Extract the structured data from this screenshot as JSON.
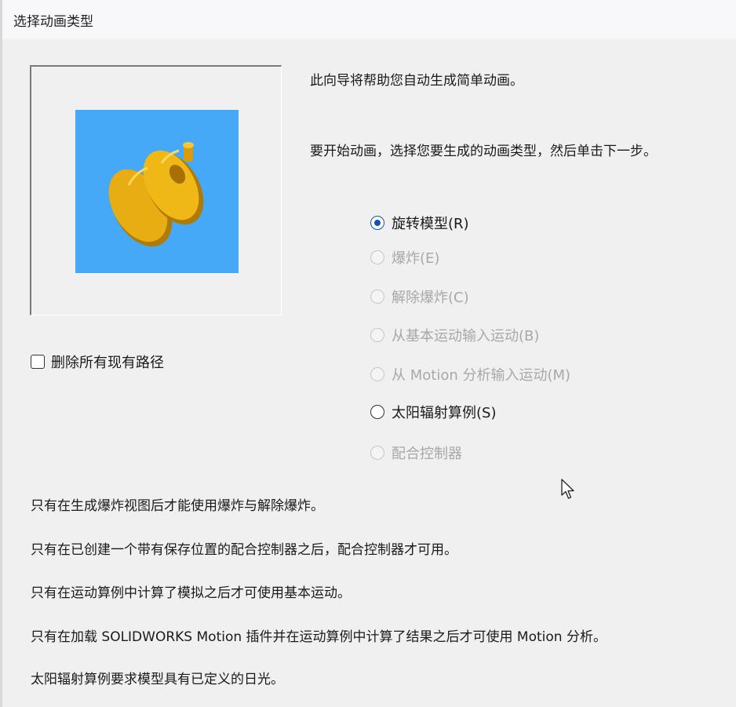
{
  "window": {
    "title": "选择动画类型"
  },
  "intro": {
    "line1": "此向导将帮助您自动生成简单动画。",
    "line2": "要开始动画，选择您要生成的动画类型，然后单击下一步。"
  },
  "preview": {
    "icon": "gear-part-3d-model",
    "background_color": "#45a9f7",
    "part_color": "#e8ad12"
  },
  "options": [
    {
      "label": "旋转模型(R)",
      "checked": true,
      "enabled": true
    },
    {
      "label": "爆炸(E)",
      "checked": false,
      "enabled": false
    },
    {
      "label": "解除爆炸(C)",
      "checked": false,
      "enabled": false
    },
    {
      "label": "从基本运动输入运动(B)",
      "checked": false,
      "enabled": false
    },
    {
      "label": "从 Motion 分析输入运动(M)",
      "checked": false,
      "enabled": false
    },
    {
      "label": "太阳辐射算例(S)",
      "checked": false,
      "enabled": true
    },
    {
      "label": "配合控制器",
      "checked": false,
      "enabled": false
    }
  ],
  "checkbox": {
    "label": "删除所有现有路径",
    "checked": false
  },
  "notes": [
    "只有在生成爆炸视图后才能使用爆炸与解除爆炸。",
    "只有在已创建一个带有保存位置的配合控制器之后，配合控制器才可用。",
    "只有在运动算例中计算了模拟之后才可使用基本运动。",
    "只有在加载 SOLIDWORKS Motion 插件并在运动算例中计算了结果之后才可使用 Motion 分析。",
    "太阳辐射算例要求模型具有已定义的日光。"
  ],
  "colors": {
    "accent": "#0a57b8",
    "disabled_text": "#a8a8a8"
  }
}
